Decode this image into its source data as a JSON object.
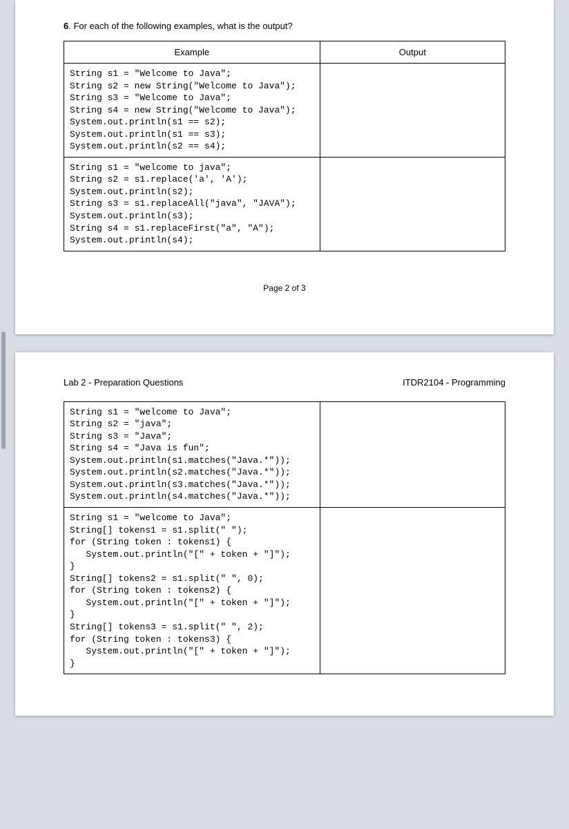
{
  "question": {
    "number": "6",
    "prompt": ". For each of the following examples, what is the output?"
  },
  "table1": {
    "headers": {
      "example": "Example",
      "output": "Output"
    },
    "rows": [
      {
        "code": "String s1 = \"Welcome to Java\";\nString s2 = new String(\"Welcome to Java\");\nString s3 = \"Welcome to Java\";\nString s4 = new String(\"Welcome to Java\");\nSystem.out.println(s1 == s2);\nSystem.out.println(s1 == s3);\nSystem.out.println(s2 == s4);",
        "output": ""
      },
      {
        "code": "String s1 = \"welcome to java\";\nString s2 = s1.replace('a', 'A');\nSystem.out.println(s2);\nString s3 = s1.replaceAll(\"java\", \"JAVA\");\nSystem.out.println(s3);\nString s4 = s1.replaceFirst(\"a\", \"A\");\nSystem.out.println(s4);",
        "output": ""
      }
    ]
  },
  "page_footer": "Page 2 of 3",
  "page2_header": {
    "left": "Lab 2 - Preparation Questions",
    "right": "ITDR2104 - Programming"
  },
  "table2": {
    "rows": [
      {
        "code": "String s1 = \"welcome to Java\";\nString s2 = \"java\";\nString s3 = \"Java\";\nString s4 = \"Java is fun\";\nSystem.out.println(s1.matches(\"Java.*\"));\nSystem.out.println(s2.matches(\"Java.*\"));\nSystem.out.println(s3.matches(\"Java.*\"));\nSystem.out.println(s4.matches(\"Java.*\"));",
        "output": ""
      },
      {
        "code": "String s1 = \"welcome to Java\";\nString[] tokens1 = s1.split(\" \");\nfor (String token : tokens1) {\n   System.out.println(\"[\" + token + \"]\");\n}\nString[] tokens2 = s1.split(\" \", 0);\nfor (String token : tokens2) {\n   System.out.println(\"[\" + token + \"]\");\n}\nString[] tokens3 = s1.split(\" \", 2);\nfor (String token : tokens3) {\n   System.out.println(\"[\" + token + \"]\");\n}",
        "output": ""
      }
    ]
  }
}
